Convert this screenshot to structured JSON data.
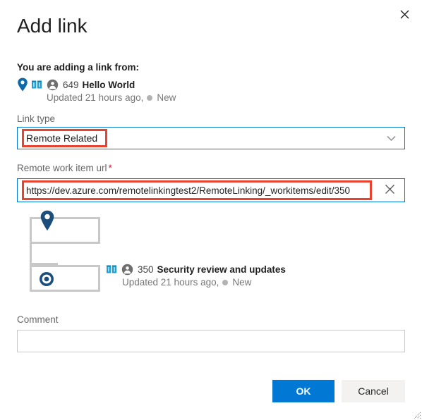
{
  "dialog": {
    "title": "Add link",
    "close_icon": "close-icon"
  },
  "source": {
    "label": "You are adding a link from:",
    "pin_icon": "location-pin-icon",
    "type_icon": "epic-book-icon",
    "avatar_icon": "person-badge-icon",
    "id": "649",
    "title": "Hello World",
    "updated": "Updated 21 hours ago,",
    "state": "New",
    "state_color": "#b2b2b2"
  },
  "link_type": {
    "label": "Link type",
    "value": "Remote Related",
    "caret_icon": "chevron-down-icon",
    "options": [
      "Remote Related"
    ],
    "highlight_color": "#e8432f",
    "focus_border_color": "#0078d4"
  },
  "remote_url": {
    "label": "Remote work item url",
    "required_marker": "*",
    "value": "https://dev.azure.com/remotelinkingtest2/RemoteLinking/_workitems/edit/350",
    "placeholder": "",
    "clear_icon": "clear-x-icon",
    "highlight_color": "#e8432f"
  },
  "tree": {
    "parent_icon": "location-pin-icon",
    "child_icon": "target-bullseye-icon"
  },
  "target": {
    "type_icon": "epic-book-icon",
    "avatar_icon": "person-badge-icon",
    "id": "350",
    "title": "Security review and updates",
    "updated": "Updated 21 hours ago,",
    "state": "New",
    "state_color": "#b2b2b2"
  },
  "comment": {
    "label": "Comment",
    "value": "",
    "placeholder": ""
  },
  "footer": {
    "ok_label": "OK",
    "cancel_label": "Cancel",
    "ok_color": "#0078d4",
    "cancel_color": "#f3f2f1"
  },
  "resize_grip": "resize-grip-icon"
}
